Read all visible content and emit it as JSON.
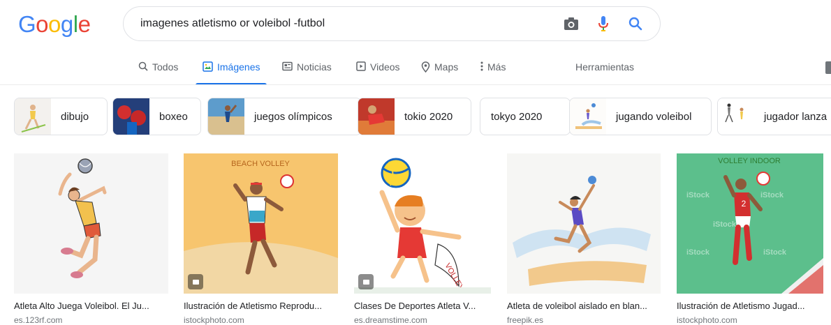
{
  "logo": {
    "letters": [
      "G",
      "o",
      "o",
      "g",
      "l",
      "e"
    ],
    "colors": [
      "#4285f4",
      "#ea4335",
      "#fbbc05",
      "#4285f4",
      "#34a853",
      "#ea4335"
    ]
  },
  "search": {
    "query": "imagenes atletismo or voleibol -futbol"
  },
  "tabs": [
    {
      "label": "Todos",
      "icon": "search-icon"
    },
    {
      "label": "Imágenes",
      "icon": "image-icon"
    },
    {
      "label": "Noticias",
      "icon": "news-icon"
    },
    {
      "label": "Videos",
      "icon": "video-icon"
    },
    {
      "label": "Maps",
      "icon": "map-pin-icon"
    },
    {
      "label": "Más",
      "icon": "more-vert-icon"
    }
  ],
  "tools_label": "Herramientas",
  "chips": [
    {
      "label": "dibujo"
    },
    {
      "label": "boxeo"
    },
    {
      "label": "juegos olímpicos"
    },
    {
      "label": "tokio 2020"
    },
    {
      "label": "tokyo 2020"
    },
    {
      "label": "jugando voleibol"
    },
    {
      "label": "jugador lanza"
    }
  ],
  "results": [
    {
      "title": "Atleta Alto Juega Voleibol. El Ju...",
      "source": "es.123rf.com"
    },
    {
      "title": "Ilustración de Atletismo Reprodu...",
      "source": "istockphoto.com",
      "overlay_text": "BEACH VOLLEY"
    },
    {
      "title": "Clases De Deportes Atleta V...",
      "source": "es.dreamstime.com",
      "overlay_text": "VOLLEYBALL"
    },
    {
      "title": "Atleta de voleibol aislado en blan...",
      "source": "freepik.es"
    },
    {
      "title": "Ilustración de Atletismo Jugad...",
      "source": "istockphoto.com",
      "overlay_text": "VOLLEY INDOOR",
      "watermark": "iStock"
    }
  ],
  "colors": {
    "accent": "#1a73e8",
    "text": "#202124",
    "muted": "#5f6368",
    "source": "#70757a"
  }
}
